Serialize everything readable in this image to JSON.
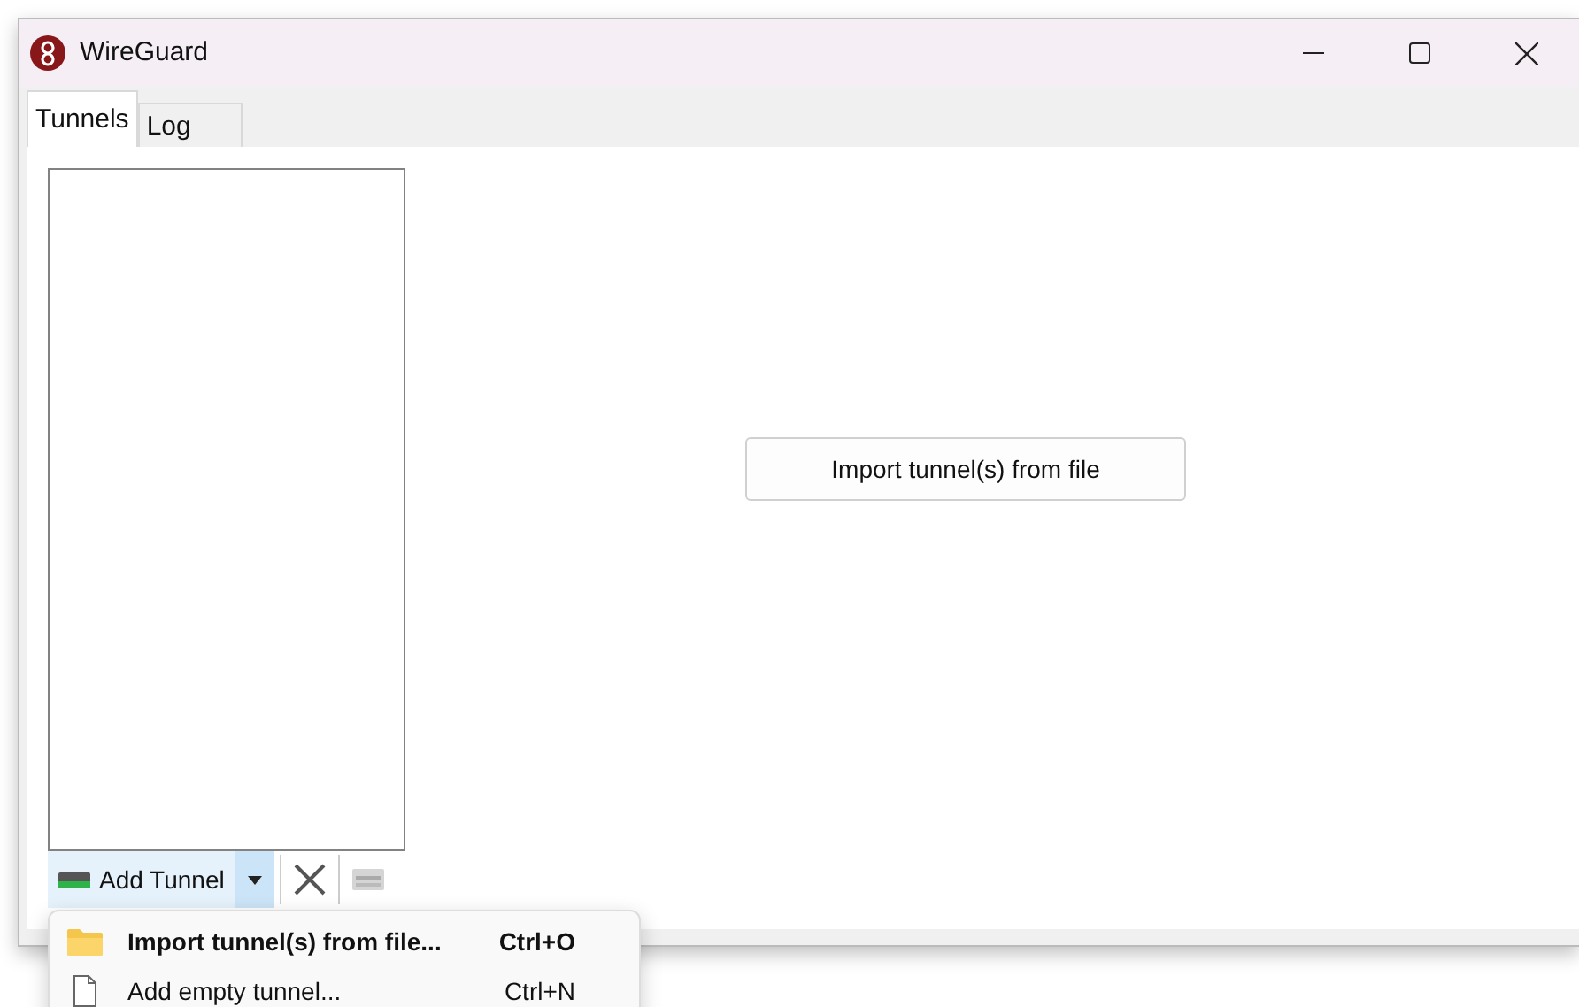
{
  "window": {
    "title": "WireGuard"
  },
  "tabs": [
    {
      "label": "Tunnels",
      "selected": true
    },
    {
      "label": "Log",
      "selected": false
    }
  ],
  "import_button": {
    "label": "Import tunnel(s) from file"
  },
  "toolbar": {
    "add_button": {
      "label": "Add Tunnel"
    },
    "dropdown_open": true
  },
  "menu": [
    {
      "kind": "folder",
      "label": "Import tunnel(s) from file...",
      "shortcut": "Ctrl+O",
      "default": true
    },
    {
      "kind": "file",
      "label": "Add empty tunnel...",
      "shortcut": "Ctrl+N",
      "default": false
    }
  ]
}
